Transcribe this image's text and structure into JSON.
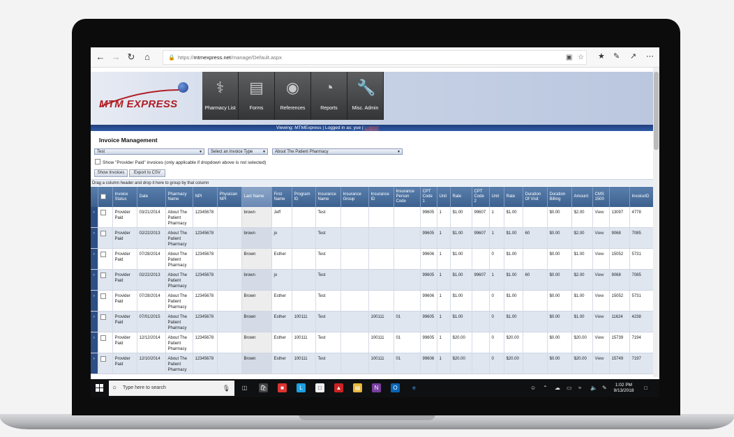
{
  "browser": {
    "url_prefix": "https://",
    "url_domain": "mtmexpress.net",
    "url_path": "/manage/Default.aspx"
  },
  "app": {
    "logo": "MTM EXPRESS",
    "tabs": [
      {
        "label": "Pharmacy List",
        "icon": "pharmacy-icon"
      },
      {
        "label": "Forms",
        "icon": "document-icon"
      },
      {
        "label": "References",
        "icon": "chat-bubbles-icon"
      },
      {
        "label": "Reports",
        "icon": "pie-chart-icon"
      },
      {
        "label": "Misc. Admin",
        "icon": "wrench-icon"
      }
    ],
    "viewing_text": "Viewing: MTMExpress | Logged in as: yue |",
    "logout_label": "Logout",
    "page_title": "Invoice Management",
    "filters": {
      "status": "Test",
      "invoice_type": "Select an Invoice Type",
      "pharmacy": "About The Patient Pharmacy"
    },
    "show_paid_label": "Show \"Provider Paid\" invoices (only applicable if dropdown above is not selected)",
    "show_invoices_label": "Show Invoices",
    "export_label": "Export to CSV",
    "group_hint": "Drag a column header and drop it here to group by that column"
  },
  "grid": {
    "columns": [
      "Invoice Status",
      "Date",
      "Pharmacy Name",
      "NPI",
      "Physician NPI",
      "Last Name",
      "First Name",
      "Program ID",
      "Insurance Name",
      "Insurance Group",
      "Insurance ID",
      "Insurance Person Code",
      "CPT Code 1",
      "Unit",
      "Rate",
      "CPT Code 2",
      "Unit",
      "Rate",
      "Duration Of Visit",
      "Duration Billing",
      "Amount",
      "CMS 1500",
      "",
      "InvoiceID"
    ],
    "rows": [
      [
        "Provider Paid",
        "03/21/2014",
        "About The Patient Pharmacy",
        "12345678",
        "",
        "brown",
        "Jeff",
        "",
        "Test",
        "",
        "",
        "",
        "99605",
        "1",
        "$1.00",
        "99607",
        "1",
        "$1.00",
        "",
        "$0.00",
        "$2.00",
        "View",
        "13097",
        "4778"
      ],
      [
        "Provider Paid",
        "02/22/2013",
        "About The Patient Pharmacy",
        "12345678",
        "",
        "brown",
        "jo",
        "",
        "Test",
        "",
        "",
        "",
        "99605",
        "1",
        "$1.00",
        "99607",
        "1",
        "$1.00",
        "60",
        "$0.00",
        "$2.00",
        "View",
        "9068",
        "7085"
      ],
      [
        "Provider Paid",
        "07/28/2014",
        "About The Patient Pharmacy",
        "12345678",
        "",
        "Brown",
        "Esther",
        "",
        "Test",
        "",
        "",
        "",
        "99606",
        "1",
        "$1.00",
        "",
        "0",
        "$1.00",
        "",
        "$0.00",
        "$1.00",
        "View",
        "15052",
        "5731"
      ],
      [
        "Provider Paid",
        "02/22/2013",
        "About The Patient Pharmacy",
        "12345678",
        "",
        "brown",
        "jo",
        "",
        "Test",
        "",
        "",
        "",
        "99605",
        "1",
        "$1.00",
        "99607",
        "1",
        "$1.00",
        "60",
        "$0.00",
        "$2.00",
        "View",
        "9068",
        "7085"
      ],
      [
        "Provider Paid",
        "07/28/2014",
        "About The Patient Pharmacy",
        "12345678",
        "",
        "Brown",
        "Esther",
        "",
        "Test",
        "",
        "",
        "",
        "99606",
        "1",
        "$1.00",
        "",
        "0",
        "$1.00",
        "",
        "$0.00",
        "$1.00",
        "View",
        "15052",
        "5731"
      ],
      [
        "Provider Paid",
        "07/01/2015",
        "About The Patient Pharmacy",
        "12345678",
        "",
        "Brown",
        "Esther",
        "100111",
        "Test",
        "",
        "100111",
        "01",
        "99605",
        "1",
        "$1.00",
        "",
        "0",
        "$1.00",
        "",
        "$0.00",
        "$1.00",
        "View",
        "11624",
        "4238"
      ],
      [
        "Provider Paid",
        "12/12/2014",
        "About The Patient Pharmacy",
        "12345678",
        "",
        "Brown",
        "Esther",
        "100111",
        "Test",
        "",
        "100111",
        "01",
        "99605",
        "1",
        "$20.00",
        "",
        "0",
        "$20.00",
        "",
        "$0.00",
        "$20.00",
        "View",
        "15739",
        "7194"
      ],
      [
        "Provider Paid",
        "12/10/2014",
        "About The Patient Pharmacy",
        "12345678",
        "",
        "Brown",
        "Esther",
        "100111",
        "Test",
        "",
        "100111",
        "01",
        "99606",
        "1",
        "$20.00",
        "",
        "0",
        "$20.00",
        "",
        "$0.00",
        "$20.00",
        "View",
        "15749",
        "7197"
      ]
    ]
  },
  "taskbar": {
    "search_placeholder": "Type here to search",
    "time": "1:02 PM",
    "date": "9/13/2018"
  }
}
